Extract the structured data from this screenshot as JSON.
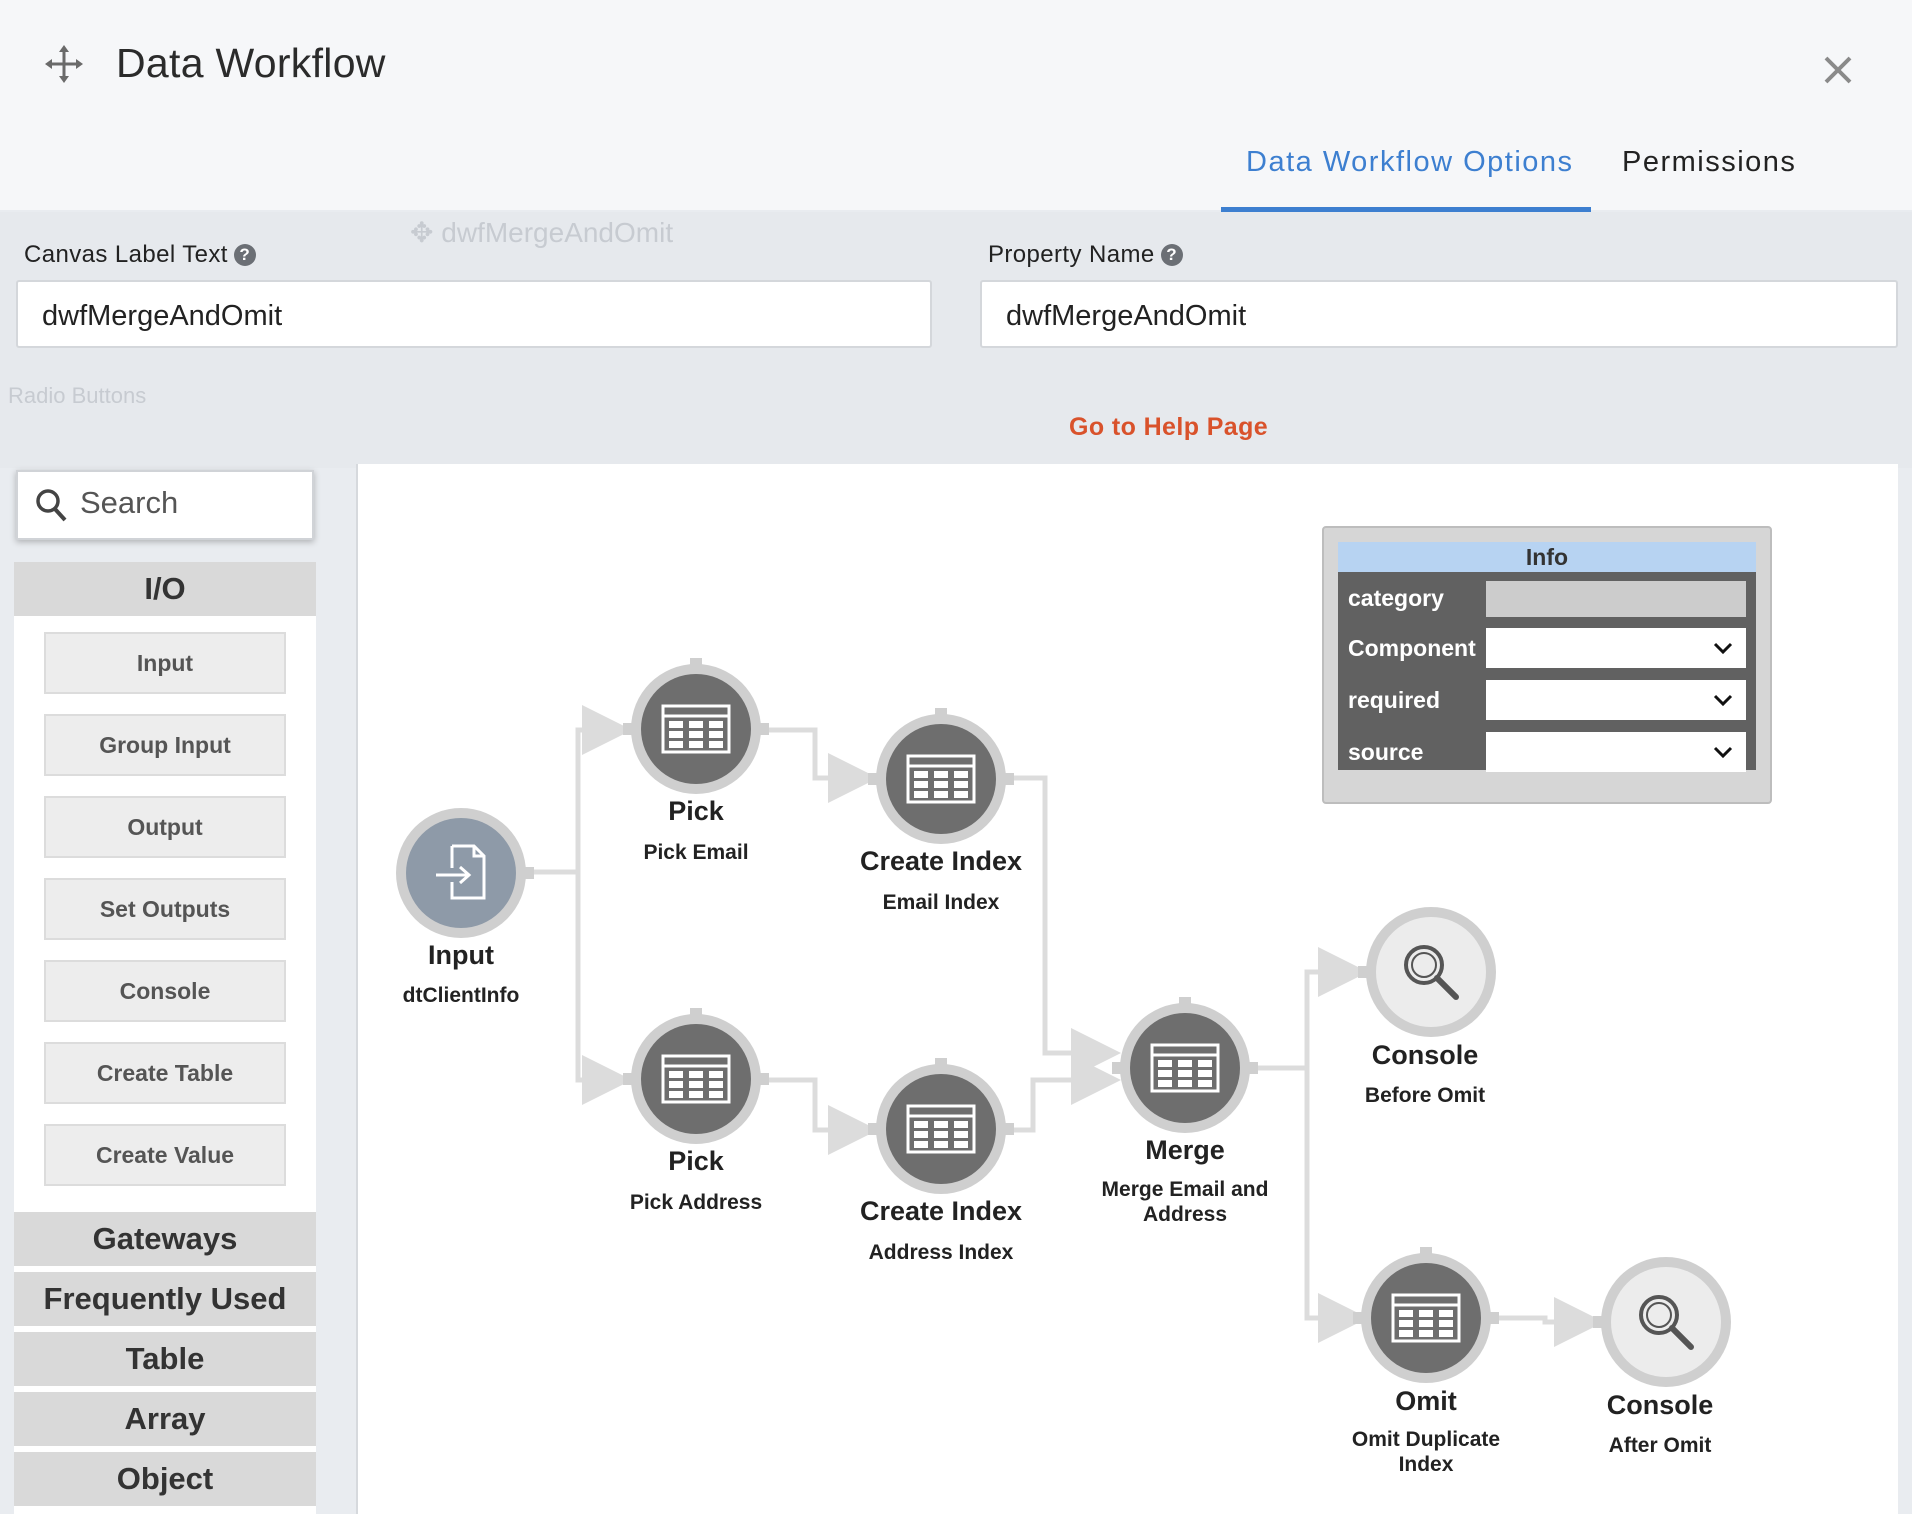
{
  "header": {
    "title": "Data Workflow",
    "tabs": [
      {
        "label": "Data Workflow Options"
      },
      {
        "label": "Permissions"
      }
    ]
  },
  "background": {
    "ghost_title": "dwfMergeAndOmit",
    "ghost_radio": "Radio Buttons"
  },
  "form": {
    "canvas_label": "Canvas Label Text",
    "canvas_value": "dwfMergeAndOmit",
    "property_label": "Property Name",
    "property_value": "dwfMergeAndOmit",
    "help_link": "Go to Help Page",
    "help_glyph": "?"
  },
  "palette": {
    "search_placeholder": "Search",
    "io_header": "I/O",
    "io_items": [
      "Input",
      "Group Input",
      "Output",
      "Set Outputs",
      "Console",
      "Create Table",
      "Create Value"
    ],
    "categories": [
      "Gateways",
      "Frequently Used",
      "Table",
      "Array",
      "Object"
    ]
  },
  "nodes": [
    {
      "title": "Input",
      "subtitle": "dtClientInfo",
      "icon": "input-file-icon"
    },
    {
      "title": "Pick",
      "subtitle": "Pick Email",
      "icon": "table-icon"
    },
    {
      "title": "Create Index",
      "subtitle": "Email Index",
      "icon": "table-icon"
    },
    {
      "title": "Pick",
      "subtitle": "Pick Address",
      "icon": "table-icon"
    },
    {
      "title": "Create Index",
      "subtitle": "Address Index",
      "icon": "table-icon"
    },
    {
      "title": "Merge",
      "subtitle": "Merge Email and Address",
      "icon": "table-icon"
    },
    {
      "title": "Console",
      "subtitle": "Before Omit",
      "icon": "magnifier-icon"
    },
    {
      "title": "Omit",
      "subtitle": "Omit Duplicate Index",
      "icon": "table-icon"
    },
    {
      "title": "Console",
      "subtitle": "After Omit",
      "icon": "magnifier-icon"
    }
  ],
  "info_panel": {
    "title": "Info",
    "rows": [
      {
        "label": "category",
        "value": ""
      },
      {
        "label": "Component",
        "value": ""
      },
      {
        "label": "required",
        "value": ""
      },
      {
        "label": "source",
        "value": ""
      }
    ]
  },
  "colors": {
    "accent": "#3d7fd0",
    "help_link": "#d9522b",
    "node_dark": "#6e6e6e",
    "node_input": "#8e9aa8",
    "info_header": "#b7d3f2"
  }
}
